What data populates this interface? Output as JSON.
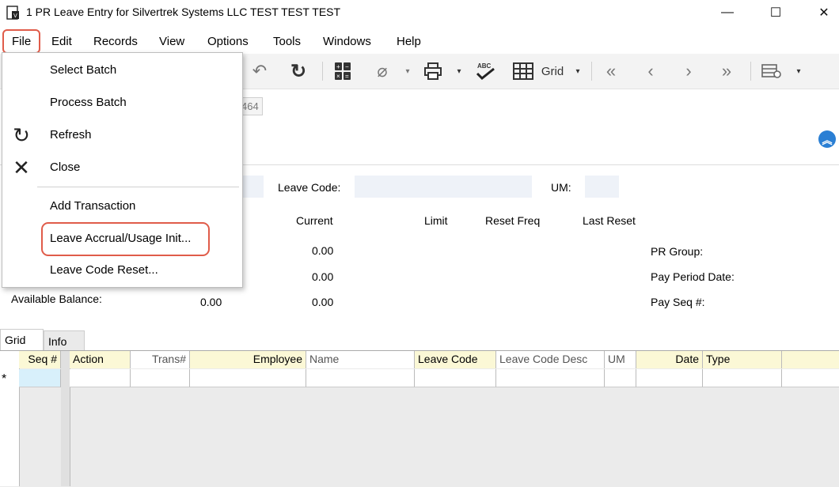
{
  "window": {
    "title": "1 PR Leave Entry for Silvertrek Systems LLC TEST TEST TEST",
    "controls": {
      "minimize": "—",
      "maximize": "☐",
      "close": "✕"
    }
  },
  "menubar": {
    "items": [
      "File",
      "Edit",
      "Records",
      "View",
      "Options",
      "Tools",
      "Windows",
      "Help"
    ]
  },
  "toolbar": {
    "grid_label": "Grid"
  },
  "file_menu": {
    "items": [
      "Select Batch",
      "Process Batch",
      "Refresh",
      "Close",
      "Add Transaction",
      "Leave Accrual/Usage Init...",
      "Leave Code Reset..."
    ]
  },
  "form": {
    "batch_partial": "464",
    "leave_code_label": "Leave Code:",
    "um_label": "UM:",
    "col_current": "Current",
    "col_limit": "Limit",
    "col_reset_freq": "Reset Freq",
    "col_last_reset": "Last Reset",
    "current_values": [
      "0.00",
      "0.00",
      "0.00"
    ],
    "available_balance_label": "Available Balance:",
    "available_balance_value": "0.00",
    "pr_group_label": "PR Group:",
    "pay_period_date_label": "Pay Period Date:",
    "pay_seq_label": "Pay Seq #:"
  },
  "tabs": [
    "Grid",
    "Info"
  ],
  "grid": {
    "columns": [
      "Seq #",
      "Action",
      "Trans#",
      "Employee",
      "Name",
      "Leave Code",
      "Leave Code Desc",
      "UM",
      "Date",
      "Type"
    ],
    "new_row_marker": "*"
  },
  "colors": {
    "highlight": "#e05c4a",
    "required_header": "#fbf8d6",
    "input_bg": "#eef2f8",
    "accent": "#2a7fd4"
  }
}
